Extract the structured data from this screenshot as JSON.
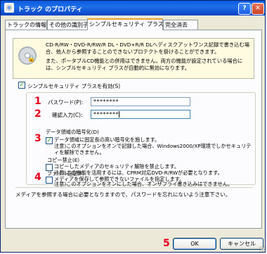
{
  "window": {
    "title": "トラック のプロパティ",
    "help_glyph": "?",
    "close_glyph": "✕"
  },
  "tabs": [
    {
      "label": "トラックの情報"
    },
    {
      "label": "その他の識別子"
    },
    {
      "label": "シンプルセキュリティ プラス",
      "active": true
    },
    {
      "label": "完全消去"
    }
  ],
  "info": {
    "line1": "CD-R/RW・DVD-R/RW/R DL・DVD+R/R DLへディスクアットワンス記録で書き込む場合、他人から参照することのできないプロテクトを掛けることができます。",
    "line2": "また、ポータブルCD機能との併用はできません。両方の機能が設定されている場合には、シンプルセキュリティ プラスが自動的に無効になります。"
  },
  "enable_checkbox": {
    "label": "シンプルセキュリティ プラスを有効(S)",
    "checked": true
  },
  "password": {
    "label": "パスワード(P):",
    "value": "********"
  },
  "confirm": {
    "label": "確認入力(C):",
    "value": "********"
  },
  "encryption": {
    "label": "データ領域の暗号化(D)",
    "desc1": "データ領域に固定長の高い暗号化を施します。",
    "desc2": "注意)このオプションをオンで記録した場合、Windows2000/XP環境でしかセキュリティを解除できません。",
    "checked": true
  },
  "copy_protect": {
    "label": "コピー禁止(E)",
    "desc1": "コピーしたメディアのセキュリティ解除を禁止します。",
    "desc2": "注意)この機能を活用するには、CPRM対応DVD-R/RWが必要となります。",
    "checked": false
  },
  "file_specify": {
    "label": "ファイル指定(F)",
    "desc1": "メディアを保存して参照できないファイルを指定します。",
    "desc2": "注意)このオプションをオンにした場合、オンザフライ書き込みはできません。",
    "checked": false
  },
  "footer_note": "メディアを参照する場合に必要となりますので、パスワードを忘れにないよう注意下さい。",
  "markers": {
    "m1": "1",
    "m2": "2",
    "m3": "3",
    "m4": "4",
    "m5": "5"
  },
  "buttons": {
    "ok": "OK",
    "cancel": "キャンセル"
  },
  "colors": {
    "marker_red": "#e8001c",
    "titlebar_blue": "#0a5be0"
  }
}
